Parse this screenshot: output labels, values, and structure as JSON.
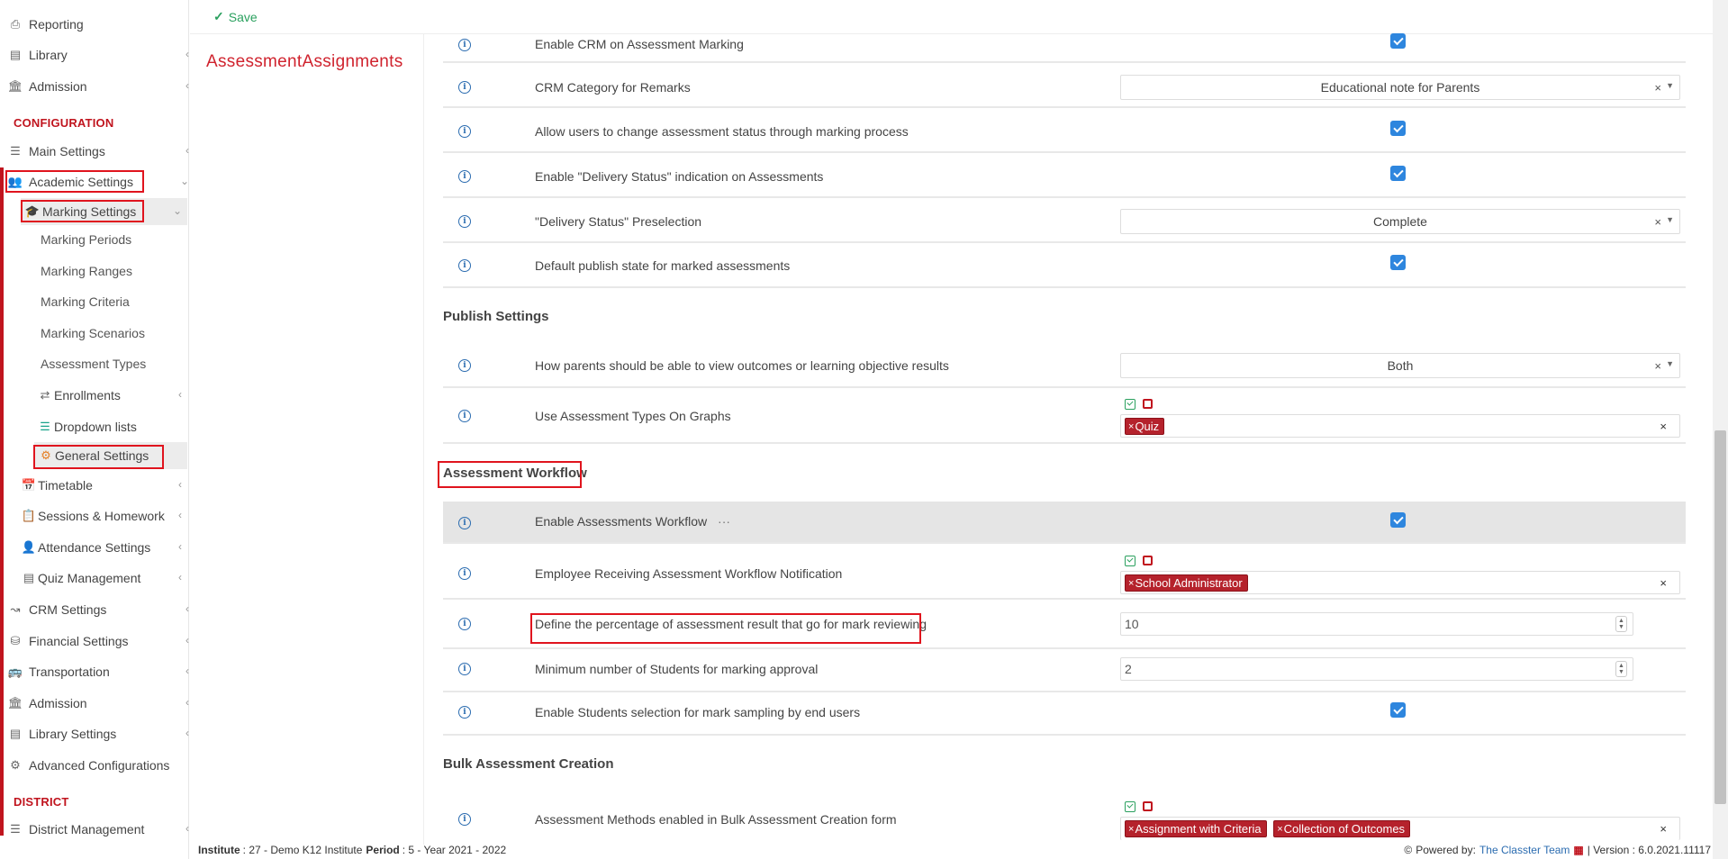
{
  "topbar": {
    "save_label": "Save"
  },
  "page_title": "AssessmentAssignments",
  "sidebar": {
    "reporting": "Reporting",
    "library": "Library",
    "admission": "Admission",
    "configuration_header": "CONFIGURATION",
    "main_settings": "Main Settings",
    "academic_settings": "Academic Settings",
    "marking_settings": "Marking Settings",
    "marking_periods": "Marking Periods",
    "marking_ranges": "Marking Ranges",
    "marking_criteria": "Marking Criteria",
    "marking_scenarios": "Marking Scenarios",
    "assessment_types": "Assessment Types",
    "enrollments": "Enrollments",
    "dropdown_lists": "Dropdown lists",
    "general_settings": "General Settings",
    "timetable": "Timetable",
    "sessions_homework": "Sessions & Homework",
    "attendance_settings": "Attendance Settings",
    "quiz_management": "Quiz Management",
    "crm_settings": "CRM Settings",
    "financial_settings": "Financial Settings",
    "transportation": "Transportation",
    "admission2": "Admission",
    "library_settings": "Library Settings",
    "advanced_configurations": "Advanced Configurations",
    "district_header": "DISTRICT",
    "district_management": "District Management"
  },
  "rows": {
    "enable_crm": "Enable CRM on Assessment Marking",
    "crm_category": "CRM Category for Remarks",
    "crm_category_value": "Educational note for Parents",
    "allow_status_change": "Allow users to change assessment status through marking process",
    "enable_delivery_status": "Enable \"Delivery Status\" indication on Assessments",
    "delivery_preselection": "\"Delivery Status\" Preselection",
    "delivery_preselection_value": "Complete",
    "default_publish_state": "Default publish state for marked assessments",
    "publish_settings_header": "Publish Settings",
    "parents_view": "How parents should be able to view outcomes or learning objective results",
    "parents_view_value": "Both",
    "use_types_graphs": "Use Assessment Types On Graphs",
    "use_types_graphs_tag": "Quiz",
    "workflow_header": "Assessment Workflow",
    "enable_workflow": "Enable Assessments Workflow",
    "enable_workflow_dots": "···",
    "employee_notification": "Employee Receiving Assessment Workflow Notification",
    "employee_notification_tag": "School Administrator",
    "define_percentage": "Define the percentage of assessment result that go for mark reviewing",
    "define_percentage_value": "10",
    "min_students": "Minimum number of Students for marking approval",
    "min_students_value": "2",
    "enable_students_selection": "Enable Students selection for mark sampling by end users",
    "bulk_header": "Bulk Assessment Creation",
    "bulk_methods": "Assessment Methods enabled in Bulk Assessment Creation form",
    "bulk_tag_1": "Assignment with Criteria",
    "bulk_tag_2": "Collection of Outcomes"
  },
  "footer": {
    "institute_label": "Institute",
    "institute_value": ": 27 - Demo K12 Institute",
    "period_label": "Period",
    "period_value": ": 5 - Year 2021 - 2022",
    "powered_by": "Powered by:",
    "team": "The Classter Team",
    "version": "| Version : 6.0.2021.11117"
  },
  "colors": {
    "accent_red": "#c0141e",
    "checkbox_blue": "#2e86de",
    "save_green": "#2aa05e",
    "tag_red": "#b5222c"
  }
}
